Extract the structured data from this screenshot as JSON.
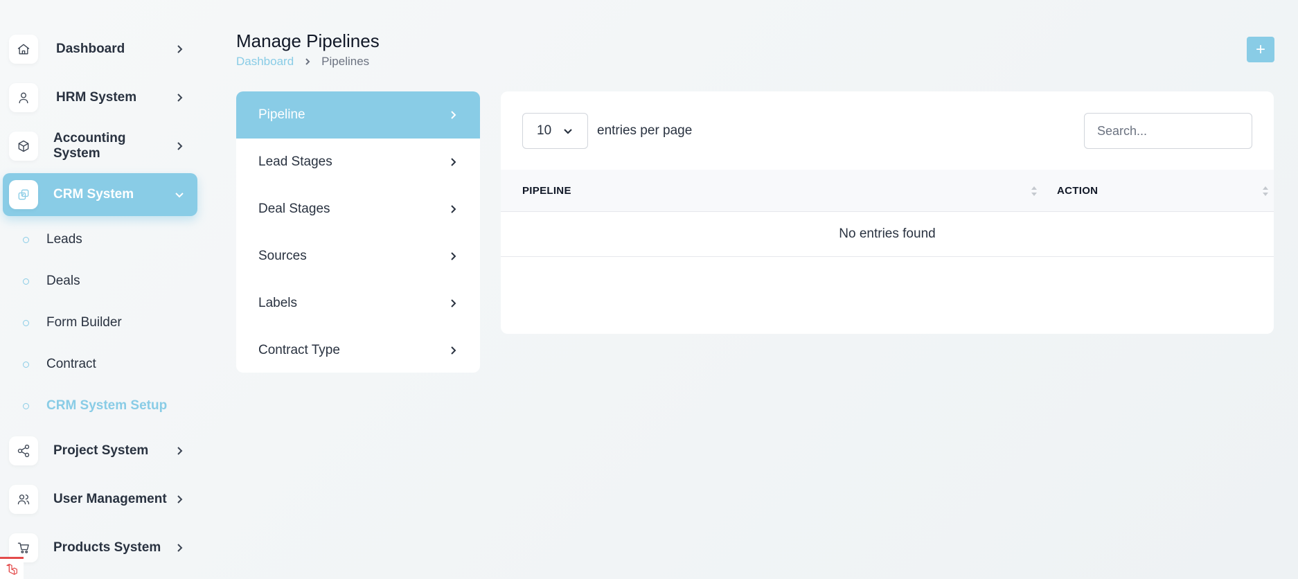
{
  "sidebar": {
    "nav": [
      {
        "label": "Dashboard",
        "icon": "home-icon"
      },
      {
        "label": "HRM System",
        "icon": "user-icon"
      },
      {
        "label": "Accounting System",
        "icon": "box-icon"
      },
      {
        "label": "CRM System",
        "icon": "layers-icon",
        "expanded": true
      },
      {
        "label": "Project System",
        "icon": "share-icon"
      },
      {
        "label": "User Management",
        "icon": "users-icon"
      },
      {
        "label": "Products System",
        "icon": "cart-icon"
      }
    ],
    "crm_sub": [
      {
        "label": "Leads"
      },
      {
        "label": "Deals"
      },
      {
        "label": "Form Builder"
      },
      {
        "label": "Contract"
      },
      {
        "label": "CRM System Setup",
        "current": true
      }
    ]
  },
  "header": {
    "title": "Manage Pipelines",
    "breadcrumb": {
      "link": "Dashboard",
      "current": "Pipelines"
    },
    "add_button": "+"
  },
  "settings_menu": {
    "items": [
      {
        "label": "Pipeline",
        "active": true
      },
      {
        "label": "Lead Stages"
      },
      {
        "label": "Deal Stages"
      },
      {
        "label": "Sources"
      },
      {
        "label": "Labels"
      },
      {
        "label": "Contract Type"
      }
    ]
  },
  "table": {
    "per_page_value": "10",
    "per_page_text": "entries per page",
    "search_placeholder": "Search...",
    "columns": [
      "PIPELINE",
      "ACTION"
    ],
    "empty_text": "No entries found"
  },
  "colors": {
    "accent": "#89cce6",
    "text": "#293240"
  }
}
